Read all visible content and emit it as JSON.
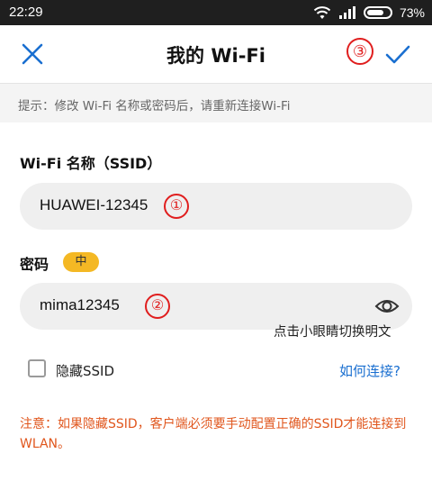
{
  "status_bar": {
    "time": "22:29",
    "battery_text": "73%",
    "battery_level": 0.73
  },
  "header": {
    "title": "我的 Wi-Fi",
    "annotation": "③"
  },
  "hint": "提示：修改 Wi-Fi 名称或密码后，请重新连接Wi-Fi",
  "ssid": {
    "label": "Wi-Fi 名称（SSID）",
    "value": "HUAWEI-12345",
    "annotation": "①"
  },
  "password": {
    "label": "密码",
    "strength": "中",
    "value": "mima12345",
    "annotation": "②",
    "eye_hint": "点击小眼睛切换明文"
  },
  "hide_ssid": {
    "label": "隐藏SSID",
    "checked": false
  },
  "help_link": "如何连接?",
  "note": "注意：如果隐藏SSID，客户端必须要手动配置正确的SSID才能连接到WLAN。",
  "colors": {
    "accent": "#1a6fd0",
    "annotation_red": "#e01e1e",
    "warning": "#e0561d",
    "badge": "#f4b824"
  },
  "icons": [
    "wifi-icon",
    "signal-icon",
    "battery-icon",
    "close-icon",
    "check-icon",
    "eye-icon"
  ]
}
